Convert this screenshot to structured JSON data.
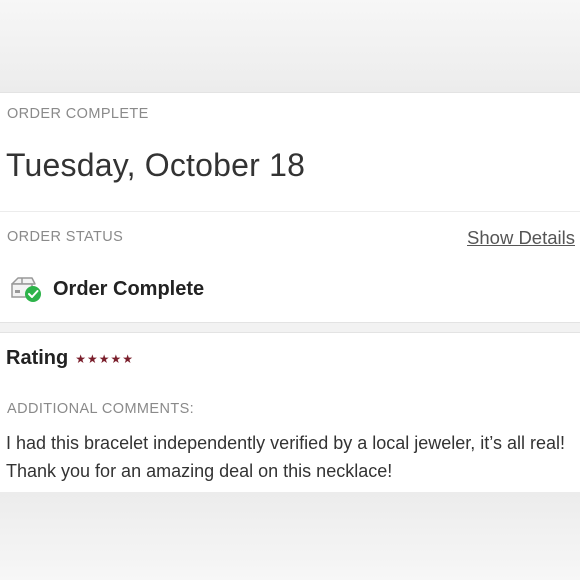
{
  "order": {
    "section_label": "ORDER COMPLETE",
    "date": "Tuesday, October 18",
    "status_label": "ORDER STATUS",
    "show_details": "Show Details",
    "status_text": "Order Complete",
    "status_icon": "package-check-icon"
  },
  "rating": {
    "label": "Rating",
    "stars": 5,
    "max_stars": 5,
    "star_color": "#7a1e2b",
    "comments_label": "ADDITIONAL COMMENTS:",
    "comment": "I had this bracelet independently verified by a local jeweler, it’s all real! Thank you for an amazing deal on this necklace!"
  },
  "colors": {
    "check_green": "#2db34a",
    "muted_label": "#8a8a8a"
  }
}
